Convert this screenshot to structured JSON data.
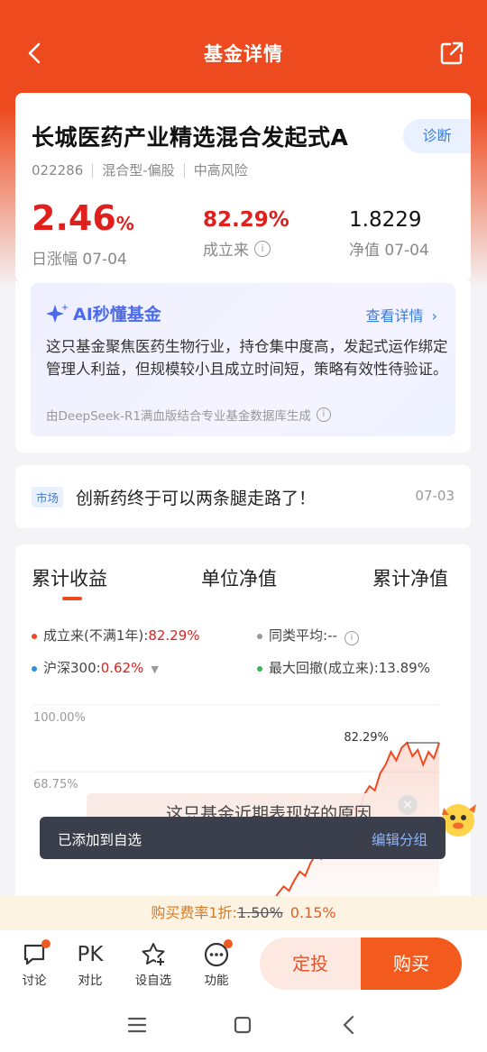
{
  "header": {
    "title": "基金详情"
  },
  "fund": {
    "name": "长城医药产业精选混合发起式A",
    "diagnose_label": "诊断",
    "code": "022286",
    "type": "混合型-偏股",
    "risk": "中高风险",
    "daily_change": "2.46",
    "daily_change_unit": "%",
    "daily_label": "日涨幅 07-04",
    "since_inception": "82.29%",
    "since_inception_label": "成立来",
    "nav": "1.8229",
    "nav_label": "净值 07-04"
  },
  "ai": {
    "title": "AI秒懂基金",
    "link": "查看详情",
    "text": "这只基金聚焦医药生物行业，持仓集中度高，发起式运作绑定管理人利益，但规模较小且成立时间短，策略有效性待验证。",
    "footer": "由DeepSeek-R1满血版结合专业基金数据库生成"
  },
  "news": {
    "tag": "市场",
    "title": "创新药终于可以两条腿走路了！",
    "date": "07-03"
  },
  "chart_tabs": [
    "累计收益",
    "单位净值",
    "累计净值"
  ],
  "legend": {
    "fund_label": "成立来(不满1年):",
    "fund_value": "82.29%",
    "peer_label": "同类平均:",
    "peer_value": "--",
    "index_label": "沪深300:",
    "index_value": "0.62%",
    "drawdown_label": "最大回撤(成立来):",
    "drawdown_value": "13.89%"
  },
  "chart_data": {
    "type": "line",
    "yticks": [
      "100.00%",
      "68.75%"
    ],
    "ylim": [
      0,
      100
    ],
    "peak_label": "82.29%",
    "series": [
      {
        "name": "成立来(不满1年)",
        "color": "#ee4a1f",
        "values": [
          0,
          2,
          4,
          3,
          6,
          9,
          8,
          12,
          15,
          13,
          18,
          22,
          20,
          26,
          30,
          28,
          34,
          38,
          42,
          40,
          46,
          52,
          50,
          58,
          62,
          60,
          68,
          72,
          78,
          74,
          80,
          82.29,
          76,
          79,
          72,
          78,
          75,
          82.29
        ]
      }
    ]
  },
  "tip": {
    "text": "这只基金近期表现好的原因"
  },
  "toast": {
    "message": "已添加到自选",
    "action": "编辑分组"
  },
  "fee": {
    "label": "购买费率1折:",
    "original": "1.50%",
    "current": "0.15%"
  },
  "bottom": {
    "discuss": "讨论",
    "pk_icon": "PK",
    "compare": "对比",
    "watchlist": "设自选",
    "functions": "功能",
    "dingtou": "定投",
    "buy": "购买"
  },
  "colors": {
    "brand": "#ee4a1f",
    "rise": "#e0201d",
    "link": "#3b7ddb"
  }
}
